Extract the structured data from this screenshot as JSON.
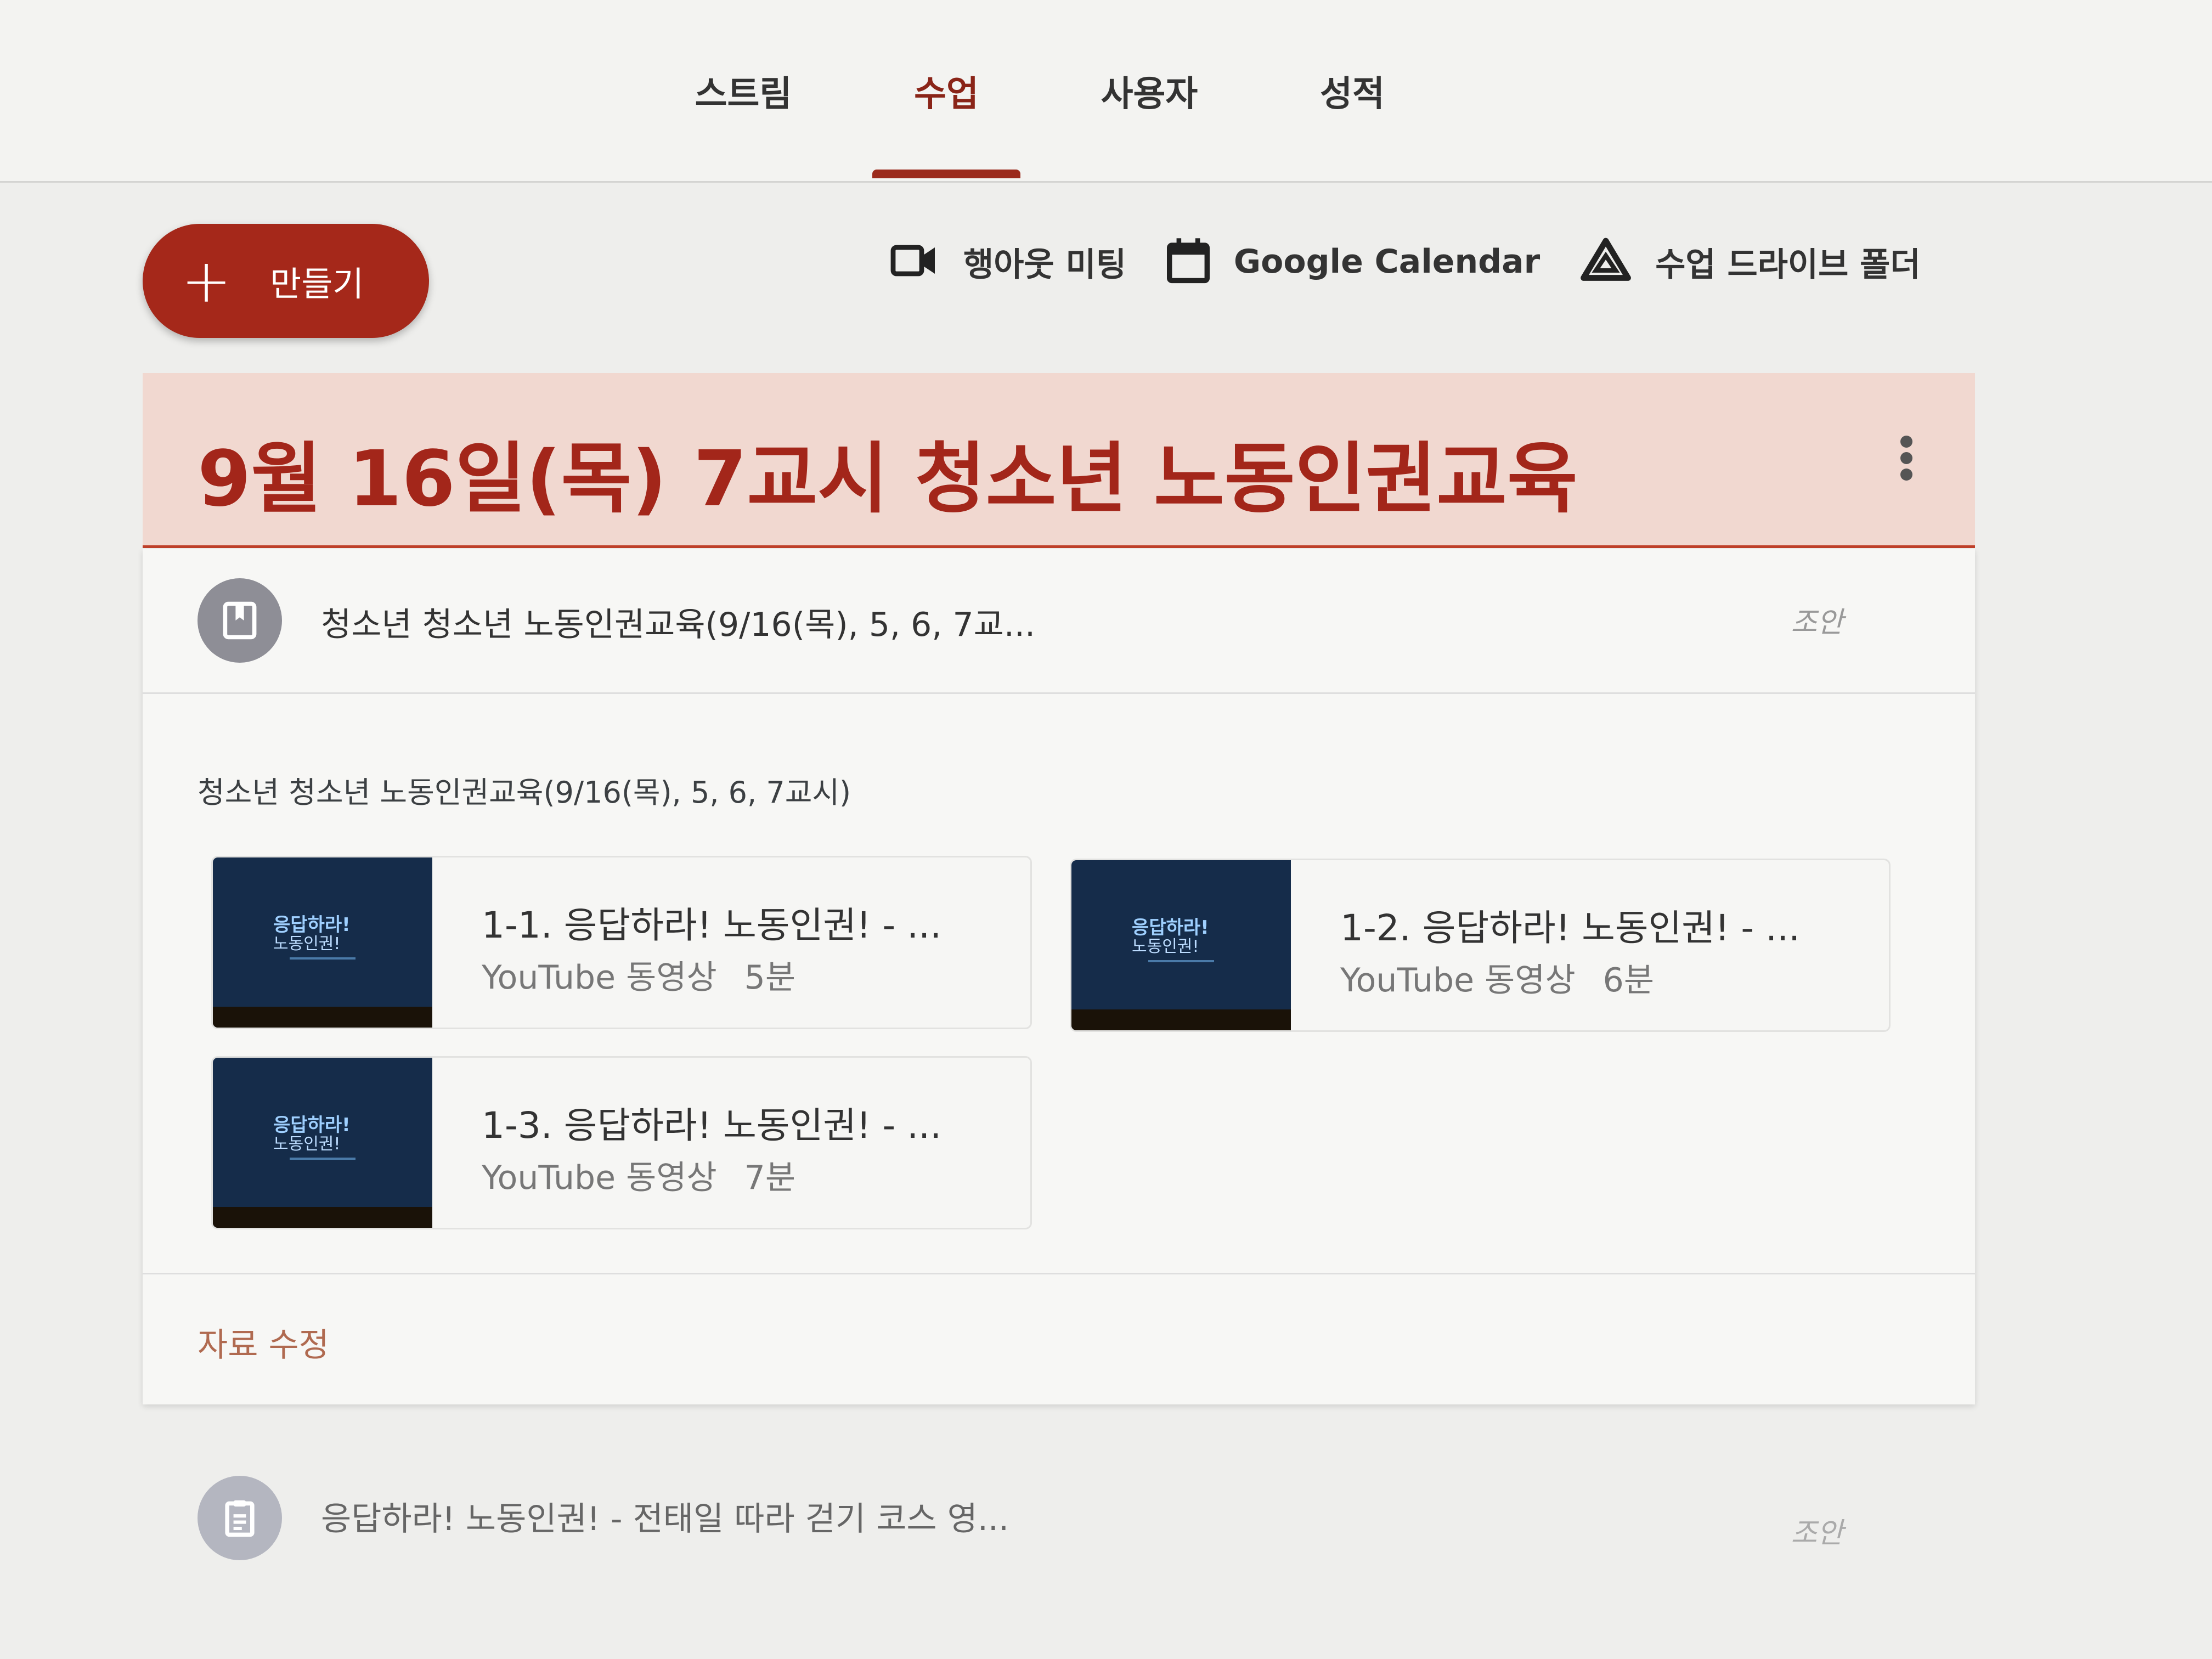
{
  "tabs": [
    {
      "label": "스트림",
      "active": false
    },
    {
      "label": "수업",
      "active": true
    },
    {
      "label": "사용자",
      "active": false
    },
    {
      "label": "성적",
      "active": false
    }
  ],
  "create": {
    "icon": "plus-icon",
    "label": "만들기"
  },
  "actions": [
    {
      "icon": "video-camera-icon",
      "label": "행아웃 미팅"
    },
    {
      "icon": "calendar-icon",
      "label": "Google Calendar"
    },
    {
      "icon": "drive-icon",
      "label": "수업 드라이브 폴더"
    }
  ],
  "topic": {
    "title": "9월 16일(목) 7교시 청소년 노동인권교육"
  },
  "material": {
    "title": "청소년 청소년 노동인권교육(9/16(목), 5, 6, 7교...",
    "date": "조안",
    "description": "청소년 청소년 노동인권교육(9/16(목), 5, 6, 7교시)",
    "attachments": [
      {
        "title": "1-1. 응답하라! 노동인권! - ...",
        "type": "YouTube 동영상",
        "duration": "5분"
      },
      {
        "title": "1-2. 응답하라! 노동인권! - ...",
        "type": "YouTube 동영상",
        "duration": "6분"
      },
      {
        "title": "1-3. 응답하라! 노동인권! - ...",
        "type": "YouTube 동영상",
        "duration": "7분"
      }
    ],
    "edit_label": "자료 수정"
  },
  "next": {
    "title": "응답하라! 노동인권! - 전태일 따라 걷기 코스 영...",
    "date": "조안"
  },
  "colors": {
    "accent": "#a5281a",
    "header_bg": "#f1d8d0"
  }
}
